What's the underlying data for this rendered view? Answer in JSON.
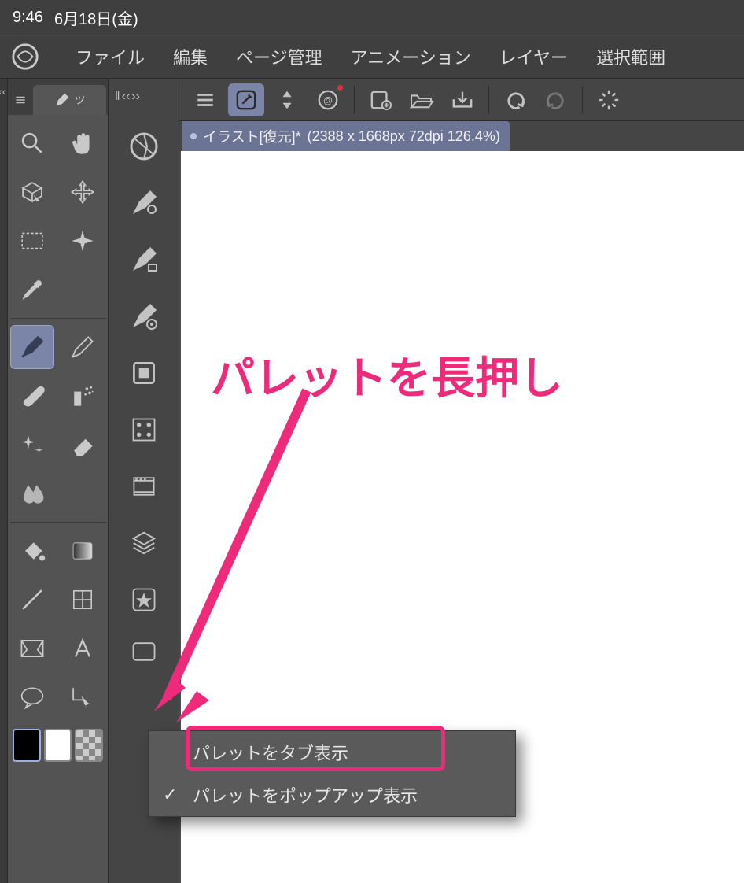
{
  "status": {
    "time": "9:46",
    "date": "6月18日(金)"
  },
  "menu": [
    {
      "label": "ファイル"
    },
    {
      "label": "編集"
    },
    {
      "label": "ページ管理"
    },
    {
      "label": "アニメーション"
    },
    {
      "label": "レイヤー"
    },
    {
      "label": "選択範囲"
    }
  ],
  "tool_tabs": {
    "active_label": "ツ"
  },
  "document": {
    "name": "イラスト[復元]*",
    "spec": "(2388 x 1668px 72dpi 126.4%)"
  },
  "tools": {
    "row1": [
      "magnifier-icon",
      "hand-icon"
    ],
    "row2": [
      "cube-select-icon",
      "move-icon"
    ],
    "row3": [
      "marquee-icon",
      "wand-icon"
    ],
    "row4": [
      "eyedropper-icon",
      ""
    ],
    "row5": [
      "pen-icon",
      "pencil-icon"
    ],
    "row6": [
      "brush-icon",
      "airbrush-icon"
    ],
    "row7": [
      "sparkle-icon",
      "eraser-icon"
    ],
    "row8": [
      "blend-icon",
      ""
    ],
    "row9": [
      "fill-icon",
      "gradient-icon"
    ],
    "row10": [
      "line-icon",
      "figure-icon"
    ],
    "row11": [
      "frame-icon",
      "text-icon"
    ],
    "row12": [
      "balloon-icon",
      "correct-line-icon"
    ]
  },
  "subtools": [
    "navigator-icon",
    "subview-icon",
    "subview2-icon",
    "subview3-icon",
    "item-bank-icon",
    "tone-icon",
    "animation-icon",
    "layer-icon",
    "material-star-icon",
    "material-icon"
  ],
  "commandbar": [
    "menu-icon",
    "clip-icon",
    "updown-icon",
    "at-icon",
    "newfile-icon",
    "open-icon",
    "save-icon",
    "undo-icon",
    "redo-icon",
    "spinner-icon"
  ],
  "annotation": {
    "label": "パレットを長押し"
  },
  "context_menu": {
    "items": [
      {
        "label": "パレットをタブ表示",
        "checked": false
      },
      {
        "label": "パレットをポップアップ表示",
        "checked": true
      }
    ]
  }
}
